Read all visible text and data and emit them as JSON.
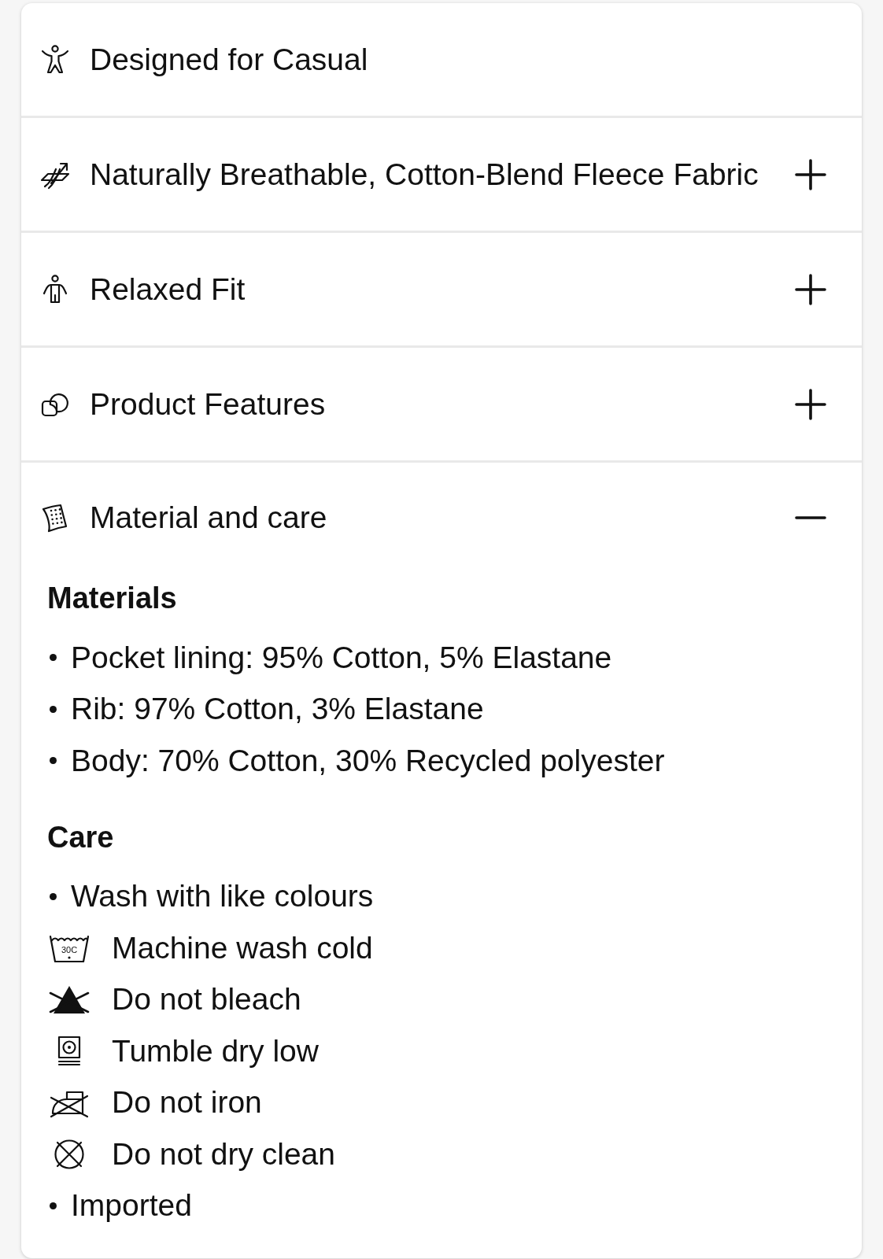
{
  "sections": [
    {
      "kind": "plain",
      "title": "Designed for Casual"
    },
    {
      "kind": "toggle",
      "title": "Naturally Breathable, Cotton-Blend Fleece Fabric",
      "expanded": false
    },
    {
      "kind": "toggle",
      "title": "Relaxed Fit",
      "expanded": false
    },
    {
      "kind": "toggle",
      "title": "Product Features",
      "expanded": false
    },
    {
      "kind": "toggle",
      "title": "Material and care",
      "expanded": true,
      "content": {
        "groups": [
          {
            "heading": "Materials",
            "items": [
              {
                "kind": "bullet",
                "text": "Pocket lining: 95% Cotton, 5% Elastane"
              },
              {
                "kind": "bullet",
                "text": "Rib: 97% Cotton, 3% Elastane"
              },
              {
                "kind": "bullet",
                "text": "Body: 70% Cotton, 30% Recycled polyester"
              }
            ]
          },
          {
            "heading": "Care",
            "items": [
              {
                "kind": "bullet",
                "text": "Wash with like colours"
              },
              {
                "kind": "symbol",
                "text": "Machine wash cold",
                "symbol_text": "30C"
              },
              {
                "kind": "symbol",
                "text": "Do not bleach"
              },
              {
                "kind": "symbol",
                "text": "Tumble dry low"
              },
              {
                "kind": "symbol",
                "text": "Do not iron"
              },
              {
                "kind": "symbol",
                "text": "Do not dry clean"
              },
              {
                "kind": "bullet",
                "text": "Imported"
              }
            ]
          }
        ]
      }
    }
  ]
}
